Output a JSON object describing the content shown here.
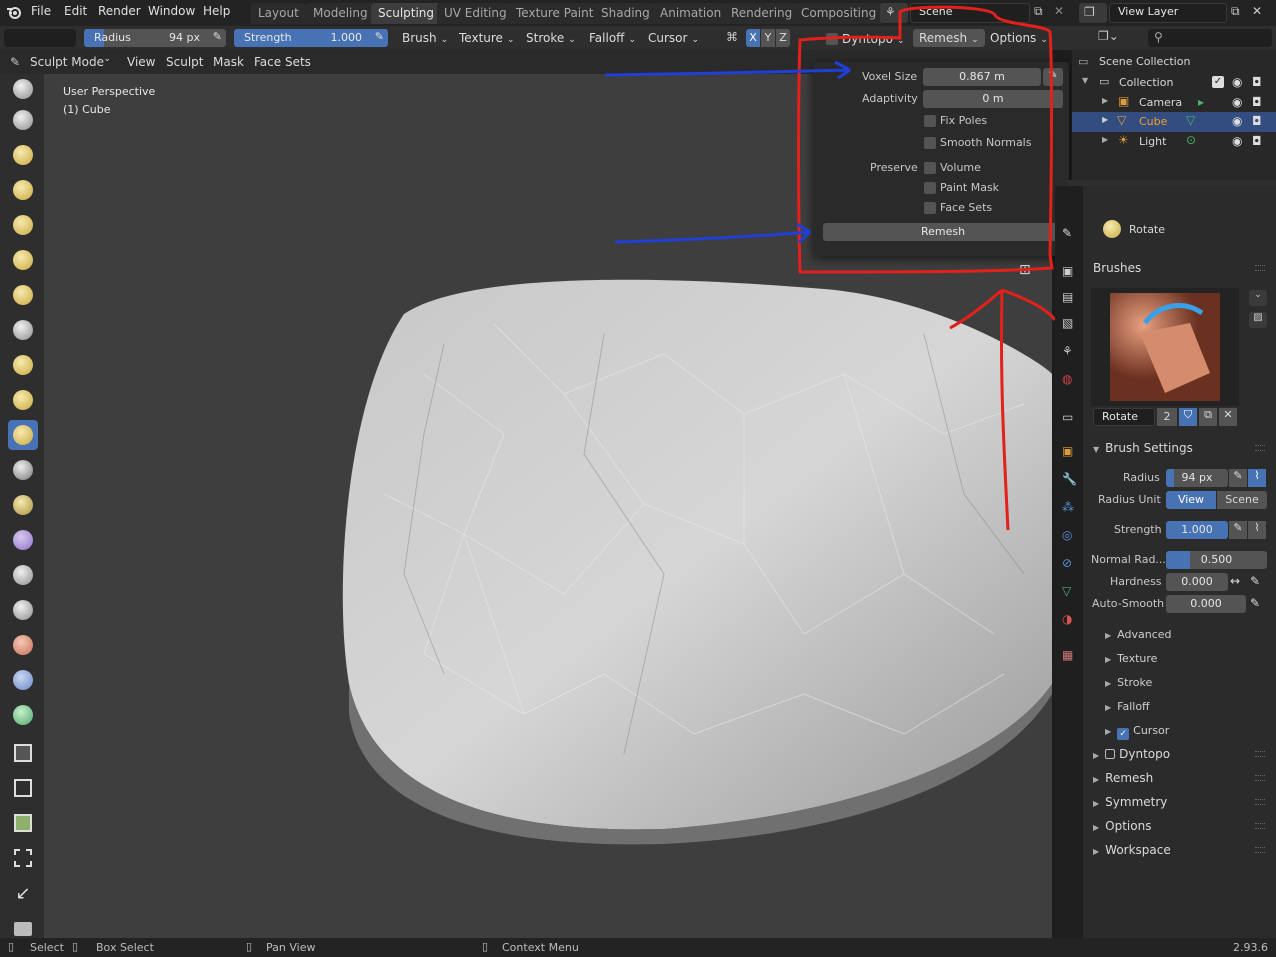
{
  "menu": [
    "File",
    "Edit",
    "Render",
    "Window",
    "Help"
  ],
  "workspaces": [
    "Layout",
    "Modeling",
    "Sculpting",
    "UV Editing",
    "Texture Paint",
    "Shading",
    "Animation",
    "Rendering",
    "Compositing"
  ],
  "scene": {
    "label": "Scene"
  },
  "view_layer": {
    "label": "View Layer"
  },
  "toolbar": {
    "radius_label": "Radius",
    "radius_value": "94 px",
    "strength_label": "Strength",
    "strength_value": "1.000",
    "brush": "Brush",
    "texture": "Texture",
    "stroke": "Stroke",
    "falloff": "Falloff",
    "cursor": "Cursor",
    "axes": [
      "X",
      "Y",
      "Z"
    ],
    "dyntopo": "Dyntopo",
    "remesh": "Remesh",
    "options": "Options"
  },
  "header": {
    "mode": "Sculpt Mode",
    "view": "View",
    "sculpt": "Sculpt",
    "mask": "Mask",
    "face_sets": "Face Sets"
  },
  "viewport": {
    "perspective": "User Perspective",
    "object": "(1) Cube"
  },
  "remesh_popup": {
    "voxel_size_label": "Voxel Size",
    "voxel_size_value": "0.867 m",
    "adaptivity_label": "Adaptivity",
    "adaptivity_value": "0 m",
    "fix_poles": "Fix Poles",
    "smooth_normals": "Smooth Normals",
    "preserve_label": "Preserve",
    "volume": "Volume",
    "paint_mask": "Paint Mask",
    "face_sets": "Face Sets",
    "remesh_button": "Remesh"
  },
  "outliner": {
    "title": "Scene Collection",
    "items": [
      {
        "label": "Collection"
      },
      {
        "label": "Camera"
      },
      {
        "label": "Cube"
      },
      {
        "label": "Light"
      }
    ]
  },
  "properties": {
    "active_tool": "Rotate",
    "brushes_header": "Brushes",
    "brush_name": "Rotate",
    "brush_users": "2",
    "brush_settings_header": "Brush Settings",
    "radius_label": "Radius",
    "radius_value": "94 px",
    "radius_unit_label": "Radius Unit",
    "radius_unit_view": "View",
    "radius_unit_scene": "Scene",
    "strength_label": "Strength",
    "strength_value": "1.000",
    "normal_radius_label": "Normal Rad...",
    "normal_radius_value": "0.500",
    "hardness_label": "Hardness",
    "hardness_value": "0.000",
    "auto_smooth_label": "Auto-Smooth",
    "auto_smooth_value": "0.000",
    "subpanels": [
      "Advanced",
      "Texture",
      "Stroke",
      "Falloff",
      "Cursor"
    ],
    "panels": [
      "Dyntopo",
      "Remesh",
      "Symmetry",
      "Options",
      "Workspace"
    ]
  },
  "status": {
    "select": "Select",
    "box_select": "Box Select",
    "pan_view": "Pan View",
    "context_menu": "Context Menu",
    "version": "2.93.6"
  },
  "colors": {
    "accent": "#4772b3",
    "annotation_red": "#e3201b",
    "annotation_blue": "#1f3fd6",
    "selected_text": "#f0a030"
  }
}
